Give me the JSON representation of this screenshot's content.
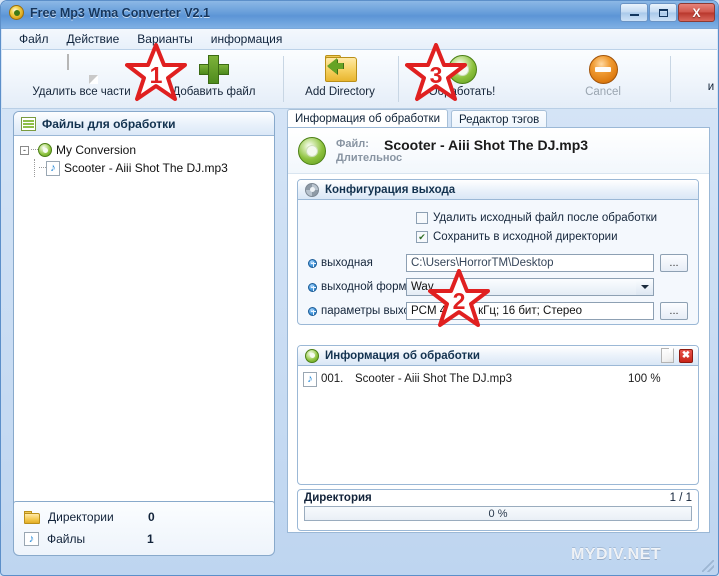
{
  "window": {
    "title": "Free Mp3 Wma Converter V2.1",
    "app_icon": "app-disc-icon",
    "buttons": {
      "minimize": "–",
      "maximize": "❐",
      "close": "X"
    }
  },
  "menu": {
    "items": [
      {
        "label": "Файл"
      },
      {
        "label": "Действие"
      },
      {
        "label": "Варианты"
      },
      {
        "label": "информация"
      }
    ]
  },
  "toolbar": {
    "items": [
      {
        "label": "Удалить все части",
        "icon": "page-icon",
        "enabled": true
      },
      {
        "label": "Добавить файл",
        "icon": "plus-icon",
        "enabled": true
      },
      {
        "label": "Add Directory",
        "icon": "folder-add-icon",
        "enabled": true
      },
      {
        "label": "Обработать!",
        "icon": "convert-icon",
        "enabled": true
      },
      {
        "label": "Cancel",
        "icon": "cancel-icon",
        "enabled": false
      }
    ],
    "cut_off_label": "и"
  },
  "annotations": [
    {
      "number": "1",
      "color": "#e02020"
    },
    {
      "number": "2",
      "color": "#e02020"
    },
    {
      "number": "3",
      "color": "#e02020"
    }
  ],
  "left_panel": {
    "header": "Файлы для обработки",
    "header_icon": "list-icon",
    "tree": {
      "root": {
        "label": "My Conversion",
        "icon": "convert-icon",
        "expander": "-"
      },
      "children": [
        {
          "label": "Scooter - Aiii Shot The DJ.mp3",
          "icon": "music-note-icon"
        }
      ]
    }
  },
  "status_panel": {
    "rows": [
      {
        "icon": "folder-icon",
        "name": "Директории",
        "value": "0"
      },
      {
        "icon": "music-note-icon",
        "name": "Файлы",
        "value": "1"
      }
    ]
  },
  "tabs": [
    {
      "label": "Информация об обработки",
      "active": true
    },
    {
      "label": "Редактор тэгов",
      "active": false
    }
  ],
  "file_header": {
    "icon": "convert-icon",
    "label_file": "Файл:",
    "label_duration": "Длительнос",
    "file_name": "Scooter - Aiii Shot The DJ.mp3"
  },
  "config_group": {
    "title": "Конфигурация выхода",
    "icon": "gear-icon",
    "checkboxes": [
      {
        "label": "Удалить исходный файл после обработки",
        "checked": false
      },
      {
        "label": "Сохранить в исходной директории",
        "checked": true
      }
    ],
    "fields": [
      {
        "label": "выходная",
        "type": "text",
        "value": "C:\\Users\\HorrorTM\\Desktop",
        "browse": "...",
        "bullet": "blue-plus-icon"
      },
      {
        "label": "выходной формат",
        "type": "select",
        "value": "Wav",
        "bullet": "blue-plus-icon"
      },
      {
        "label": "параметры выхода",
        "type": "text",
        "value": "PCM 44,100 кГц; 16 бит; Стерео",
        "browse": "...",
        "bullet": "blue-plus-icon"
      }
    ]
  },
  "info_group": {
    "title": "Информация об обработки",
    "icon": "convert-icon",
    "tools": [
      {
        "name": "new-page-icon"
      },
      {
        "name": "close-icon"
      }
    ],
    "rows": [
      {
        "icon": "music-note-icon",
        "index": "001.",
        "name": "Scooter - Aiii Shot The DJ.mp3",
        "percent": "100 %"
      }
    ]
  },
  "progress_group": {
    "label": "Директория",
    "counter": "1 / 1",
    "bar_text": "0 %",
    "bar_value": 0
  },
  "watermark": "MYDIV.NET"
}
